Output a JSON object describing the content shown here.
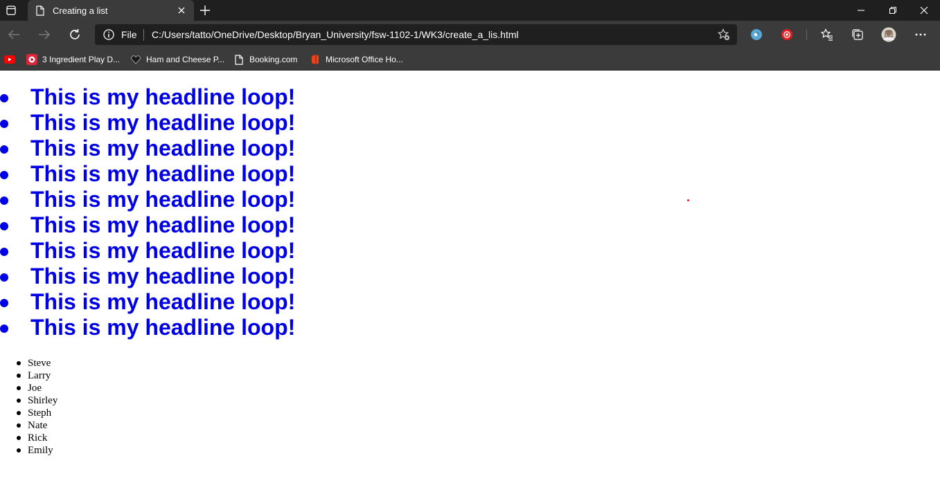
{
  "browser": {
    "tab": {
      "title": "Creating a list"
    },
    "address_bar": {
      "scheme_label": "File",
      "url": "C:/Users/tatto/OneDrive/Desktop/Bryan_University/fsw-1102-1/WK3/create_a_lis.html"
    },
    "bookmarks": [
      {
        "label": "",
        "icon": "youtube-icon"
      },
      {
        "label": "3 Ingredient Play D...",
        "icon": "recipe-icon"
      },
      {
        "label": "Ham and Cheese P...",
        "icon": "heart-icon"
      },
      {
        "label": "Booking.com",
        "icon": "page-icon"
      },
      {
        "label": "Microsoft Office Ho...",
        "icon": "office-icon"
      }
    ],
    "extensions": [
      "extension-blue-icon",
      "extension-red-icon"
    ],
    "toolbar_icons": [
      "favorites-icon",
      "collections-icon",
      "profile-avatar",
      "more-icon"
    ]
  },
  "page": {
    "headlines": [
      "This is my headline loop!",
      "This is my headline loop!",
      "This is my headline loop!",
      "This is my headline loop!",
      "This is my headline loop!",
      "This is my headline loop!",
      "This is my headline loop!",
      "This is my headline loop!",
      "This is my headline loop!",
      "This is my headline loop!"
    ],
    "names": [
      "Steve",
      "Larry",
      "Joe",
      "Shirley",
      "Steph",
      "Nate",
      "Rick",
      "Emily"
    ]
  },
  "colors": {
    "headline": "#0000e6",
    "chrome_dark": "#1f1f1f",
    "chrome": "#3b3b3b"
  }
}
